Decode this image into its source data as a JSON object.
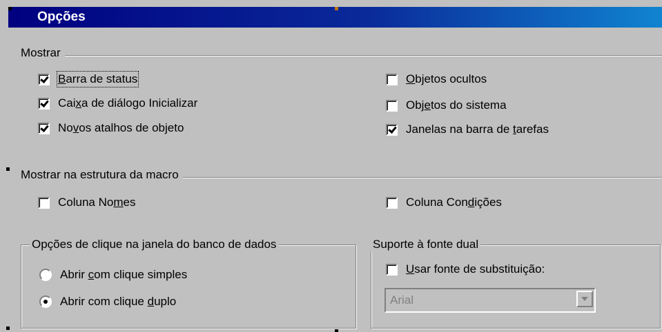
{
  "window": {
    "title": "Opções"
  },
  "show": {
    "label": "Mostrar",
    "left": [
      {
        "pre": "",
        "u": "B",
        "post": "arra de status",
        "checked": true
      },
      {
        "pre": "Cai",
        "u": "x",
        "post": "a de diálogo Inicializar",
        "checked": true
      },
      {
        "pre": "No",
        "u": "v",
        "post": "os atalhos de objeto",
        "checked": true
      }
    ],
    "right": [
      {
        "pre": "",
        "u": "O",
        "post": "bjetos ocultos",
        "checked": false
      },
      {
        "pre": "Obj",
        "u": "e",
        "post": "tos do sistema",
        "checked": false
      },
      {
        "pre": "Janelas na barra de ",
        "u": "t",
        "post": "arefas",
        "checked": true
      }
    ]
  },
  "macro": {
    "label": "Mostrar na estrutura da macro",
    "names": {
      "pre": "Coluna No",
      "u": "m",
      "post": "es",
      "checked": false
    },
    "conditions": {
      "pre": "Coluna Con",
      "u": "d",
      "post": "ições",
      "checked": false
    }
  },
  "click": {
    "label": "Opções de clique na janela do banco de dados",
    "single": {
      "pre": "Abrir ",
      "u": "c",
      "post": "om clique simples",
      "selected": false
    },
    "double": {
      "pre": "Abrir com clique ",
      "u": "d",
      "post": "uplo",
      "selected": true
    }
  },
  "dual": {
    "label": "Suporte à fonte dual",
    "use": {
      "pre": "",
      "u": "U",
      "post": "sar fonte de substituição:",
      "checked": false
    },
    "font_value": "Arial"
  }
}
